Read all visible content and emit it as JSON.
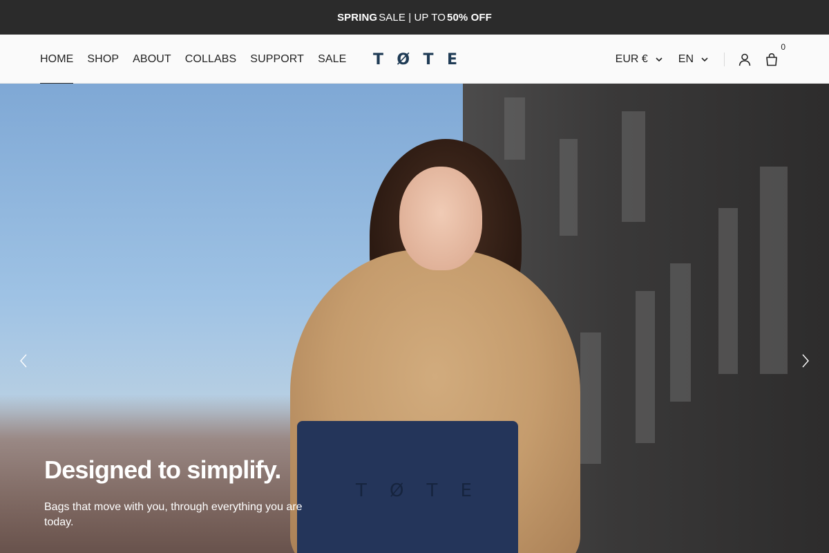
{
  "announcement": {
    "word1": "SPRING",
    "middle": "SALE | UP TO",
    "word2": "50% OFF"
  },
  "nav": {
    "items": [
      {
        "label": "HOME",
        "active": true
      },
      {
        "label": "SHOP"
      },
      {
        "label": "ABOUT"
      },
      {
        "label": "COLLABS"
      },
      {
        "label": "SUPPORT"
      },
      {
        "label": "SALE"
      }
    ]
  },
  "logo": {
    "letters": [
      "T",
      "Ø",
      "T",
      "E"
    ]
  },
  "header_right": {
    "currency": "EUR €",
    "language": "EN",
    "cart_count": "0",
    "icons": [
      "chevron-down-icon",
      "user-icon",
      "shopping-bag-icon"
    ]
  },
  "hero": {
    "title": "Designed to simplify.",
    "subtitle": "Bags that move with you, through everything you are today.",
    "bag_logo": [
      "T",
      "Ø",
      "T",
      "E"
    ],
    "icons": [
      "chevron-left-icon",
      "chevron-right-icon"
    ]
  },
  "colors": {
    "announcement_bg": "#2b2b2b",
    "header_bg": "#fafafa",
    "logo": "#1f3b55",
    "text": "#222222"
  }
}
